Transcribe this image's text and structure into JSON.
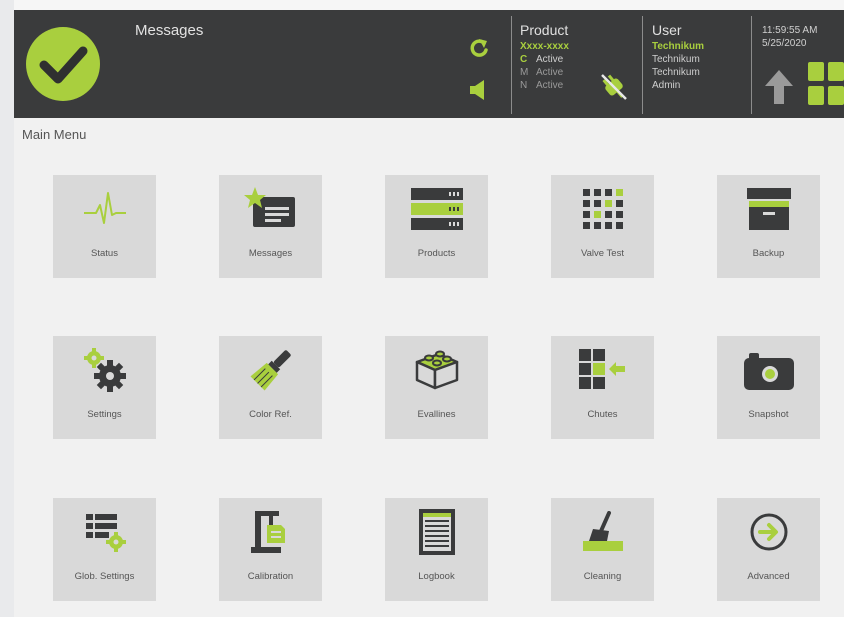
{
  "colors": {
    "accent": "#a9cf3e",
    "header_bg": "#3a3b3c",
    "tile_bg": "#d9d9d9",
    "icon_dark": "#3a3b3c"
  },
  "header": {
    "messages_label": "Messages",
    "status_icon": "checkmark-circle-icon",
    "product": {
      "title": "Product",
      "name": "Xxxx-xxxx",
      "modes": [
        {
          "letter": "C",
          "state": "Active"
        },
        {
          "letter": "M",
          "state": "Active"
        },
        {
          "letter": "N",
          "state": "Active"
        }
      ]
    },
    "user": {
      "title": "User",
      "lines": [
        "Technikum",
        "Technikum",
        "Technikum",
        "Admin"
      ]
    },
    "time": "11:59:55 AM",
    "date": "5/25/2020"
  },
  "main": {
    "title": "Main Menu",
    "tiles": [
      {
        "label": "Status",
        "icon": "heartbeat-icon"
      },
      {
        "label": "Messages",
        "icon": "messages-icon"
      },
      {
        "label": "Products",
        "icon": "products-server-icon"
      },
      {
        "label": "Valve Test",
        "icon": "valve-grid-icon"
      },
      {
        "label": "Backup",
        "icon": "archive-box-icon"
      },
      {
        "label": "Settings",
        "icon": "gears-icon"
      },
      {
        "label": "Color Ref.",
        "icon": "paint-brush-icon"
      },
      {
        "label": "Evallines",
        "icon": "building-block-icon"
      },
      {
        "label": "Chutes",
        "icon": "chutes-icon"
      },
      {
        "label": "Snapshot",
        "icon": "camera-icon"
      },
      {
        "label": "Glob. Settings",
        "icon": "global-settings-icon"
      },
      {
        "label": "Calibration",
        "icon": "calibration-clamp-icon"
      },
      {
        "label": "Logbook",
        "icon": "logbook-icon"
      },
      {
        "label": "Cleaning",
        "icon": "broom-icon"
      },
      {
        "label": "Advanced",
        "icon": "arrow-circle-right-icon"
      }
    ]
  }
}
